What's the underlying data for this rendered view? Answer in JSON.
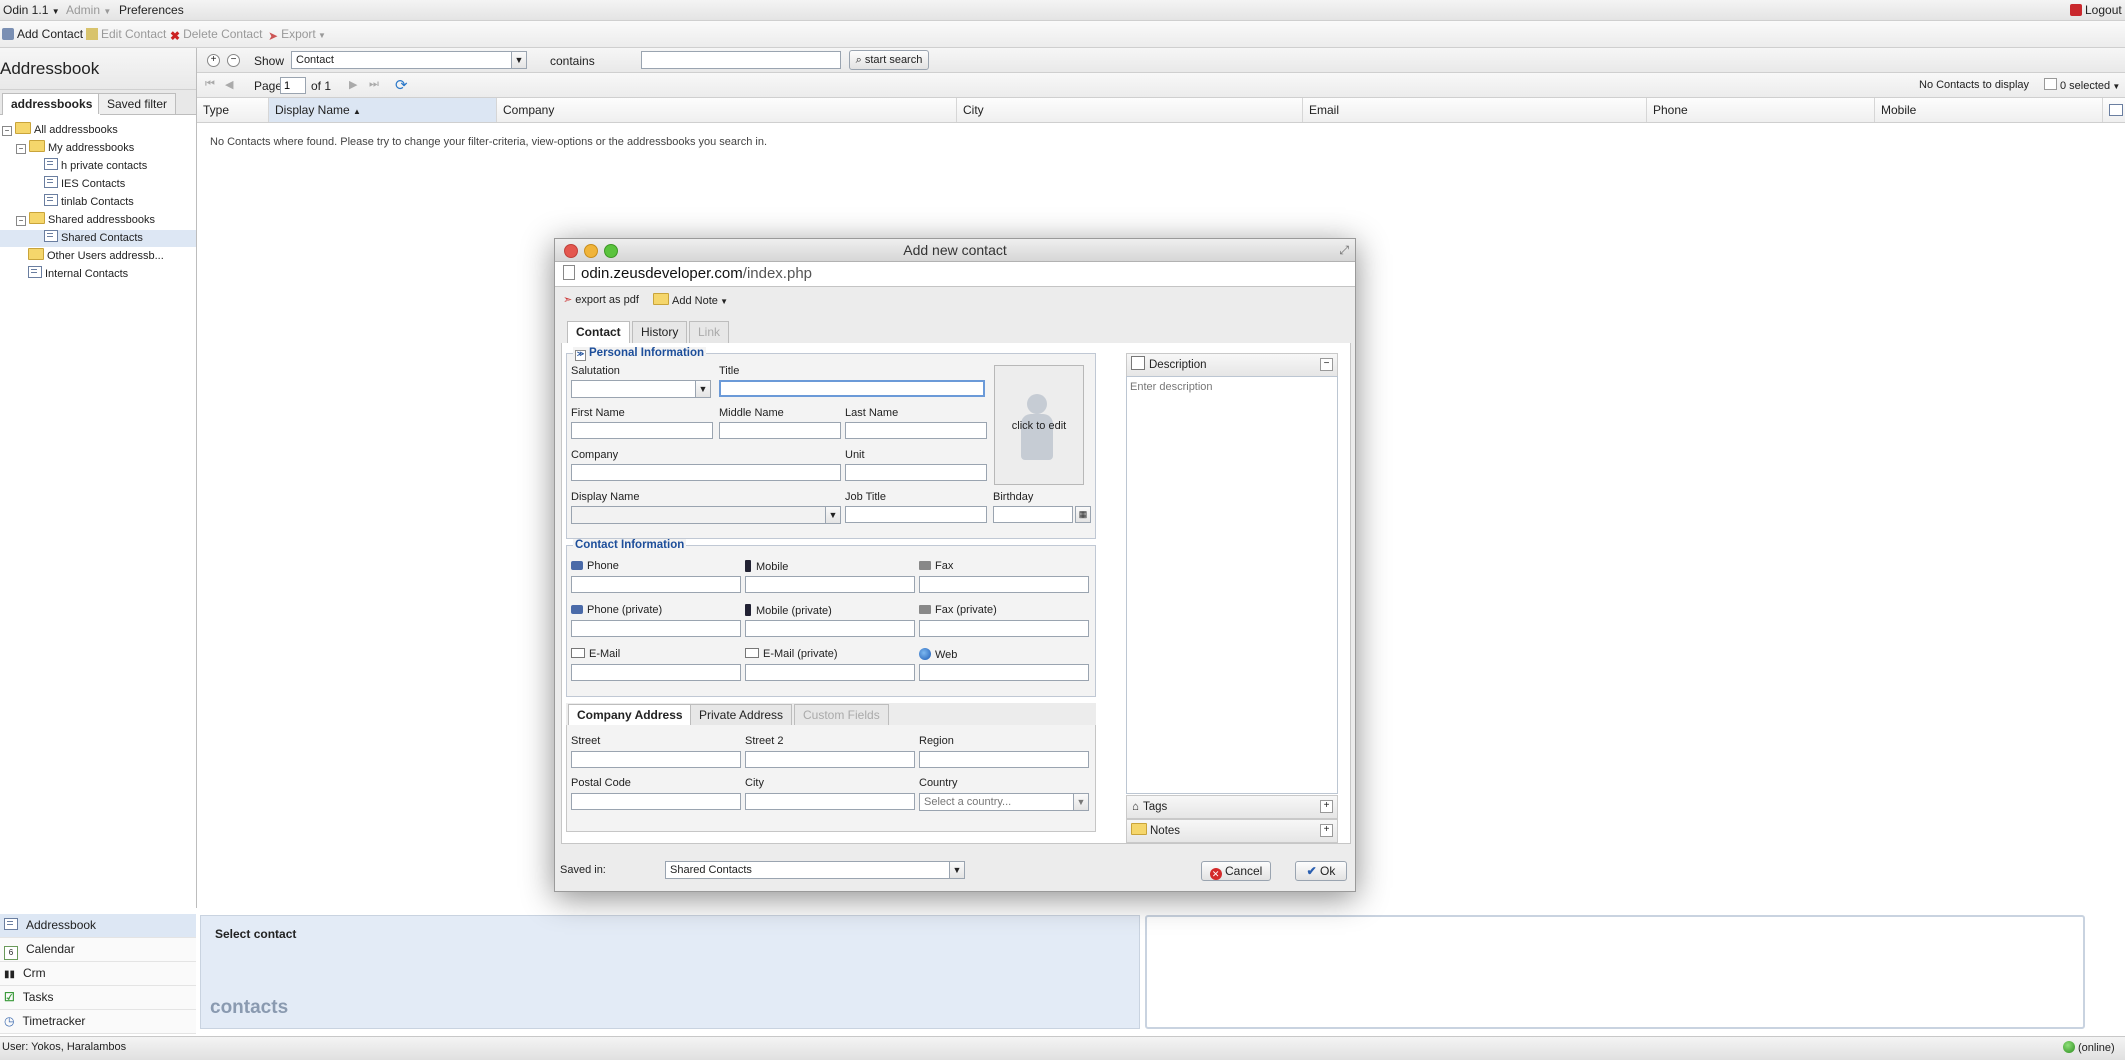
{
  "topbar": {
    "app": "Odin 1.1",
    "admin": "Admin",
    "preferences": "Preferences",
    "logout": "Logout"
  },
  "toolbar": {
    "add": "Add Contact",
    "edit": "Edit Contact",
    "delete": "Delete Contact",
    "export": "Export"
  },
  "left": {
    "title": "Addressbook",
    "tabs": [
      "addressbooks",
      "Saved filter"
    ],
    "tree": [
      "All addressbooks",
      "My addressbooks",
      "h private contacts",
      "IES Contacts",
      "tinlab Contacts",
      "Shared addressbooks",
      "Shared Contacts",
      "Other Users addressb...",
      "Internal Contacts"
    ]
  },
  "filter": {
    "show": "Show",
    "type": "Contact",
    "contains": "contains",
    "search_value": "",
    "search_btn": "start search"
  },
  "pager": {
    "page_label": "Page",
    "page": "1",
    "of": "of 1",
    "no_contacts": "No Contacts to display",
    "selected": "0 selected"
  },
  "columns": [
    "Type",
    "Display Name",
    "Company",
    "City",
    "Email",
    "Phone",
    "Mobile"
  ],
  "empty_msg": "No Contacts where found. Please try to change your filter-criteria, view-options or the addressbooks you search in.",
  "modules": [
    "Addressbook",
    "Calendar",
    "Crm",
    "Tasks",
    "Timetracker"
  ],
  "detail": {
    "title": "Select contact",
    "watermark": "contacts"
  },
  "status": {
    "user": "User: Yokos, Haralambos",
    "online": "(online)"
  },
  "dialog": {
    "title": "Add new contact",
    "url_host": "odin.zeusdeveloper.com",
    "url_path": "/index.php",
    "export_pdf": "export as pdf",
    "add_note": "Add Note",
    "tabs": [
      "Contact",
      "History",
      "Link"
    ],
    "personal": {
      "legend": "Personal Information",
      "salutation": "Salutation",
      "title": "Title",
      "first": "First Name",
      "middle": "Middle Name",
      "last": "Last Name",
      "company": "Company",
      "unit": "Unit",
      "display": "Display Name",
      "job": "Job Title",
      "birthday": "Birthday",
      "photo": "click to edit"
    },
    "contact": {
      "legend": "Contact Information",
      "phone": "Phone",
      "mobile": "Mobile",
      "fax": "Fax",
      "phone_p": "Phone (private)",
      "mobile_p": "Mobile (private)",
      "fax_p": "Fax (private)",
      "email": "E-Mail",
      "email_p": "E-Mail (private)",
      "web": "Web"
    },
    "addr_tabs": [
      "Company Address",
      "Private Address",
      "Custom Fields"
    ],
    "address": {
      "street": "Street",
      "street2": "Street 2",
      "region": "Region",
      "postal": "Postal Code",
      "city": "City",
      "country": "Country",
      "country_ph": "Select a country..."
    },
    "side": {
      "description": "Description",
      "desc_ph": "Enter description",
      "tags": "Tags",
      "notes": "Notes"
    },
    "saved_in": "Saved in:",
    "saved_value": "Shared Contacts",
    "cancel": "Cancel",
    "ok": "Ok"
  }
}
